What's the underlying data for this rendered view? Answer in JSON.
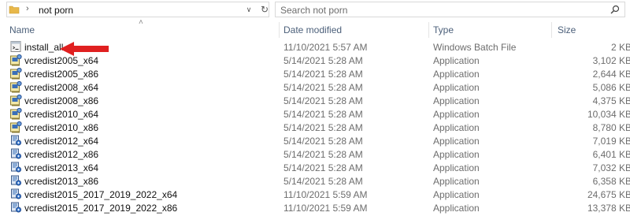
{
  "address": {
    "crumb": "not porn"
  },
  "search": {
    "placeholder": "Search not porn"
  },
  "columns": {
    "name": "Name",
    "date": "Date modified",
    "type": "Type",
    "size": "Size"
  },
  "files": [
    {
      "name": "install_all",
      "date": "11/10/2021 5:57 AM",
      "type": "Windows Batch File",
      "size": "2 KB",
      "icon": "batch-file-icon"
    },
    {
      "name": "vcredist2005_x64",
      "date": "5/14/2021 5:28 AM",
      "type": "Application",
      "size": "3,102 KB",
      "icon": "installer-icon"
    },
    {
      "name": "vcredist2005_x86",
      "date": "5/14/2021 5:28 AM",
      "type": "Application",
      "size": "2,644 KB",
      "icon": "installer-icon"
    },
    {
      "name": "vcredist2008_x64",
      "date": "5/14/2021 5:28 AM",
      "type": "Application",
      "size": "5,086 KB",
      "icon": "installer-icon"
    },
    {
      "name": "vcredist2008_x86",
      "date": "5/14/2021 5:28 AM",
      "type": "Application",
      "size": "4,375 KB",
      "icon": "installer-icon"
    },
    {
      "name": "vcredist2010_x64",
      "date": "5/14/2021 5:28 AM",
      "type": "Application",
      "size": "10,034 KB",
      "icon": "installer-icon"
    },
    {
      "name": "vcredist2010_x86",
      "date": "5/14/2021 5:28 AM",
      "type": "Application",
      "size": "8,780 KB",
      "icon": "installer-icon"
    },
    {
      "name": "vcredist2012_x64",
      "date": "5/14/2021 5:28 AM",
      "type": "Application",
      "size": "7,019 KB",
      "icon": "setup-icon"
    },
    {
      "name": "vcredist2012_x86",
      "date": "5/14/2021 5:28 AM",
      "type": "Application",
      "size": "6,401 KB",
      "icon": "setup-icon"
    },
    {
      "name": "vcredist2013_x64",
      "date": "5/14/2021 5:28 AM",
      "type": "Application",
      "size": "7,032 KB",
      "icon": "setup-icon"
    },
    {
      "name": "vcredist2013_x86",
      "date": "5/14/2021 5:28 AM",
      "type": "Application",
      "size": "6,358 KB",
      "icon": "setup-icon"
    },
    {
      "name": "vcredist2015_2017_2019_2022_x64",
      "date": "11/10/2021 5:59 AM",
      "type": "Application",
      "size": "24,675 KB",
      "icon": "setup-icon"
    },
    {
      "name": "vcredist2015_2017_2019_2022_x86",
      "date": "11/10/2021 5:59 AM",
      "type": "Application",
      "size": "13,378 KB",
      "icon": "setup-icon"
    }
  ],
  "colors": {
    "header_text": "#4c607a",
    "arrow": "#e02020",
    "folder": "#e8b84a"
  }
}
